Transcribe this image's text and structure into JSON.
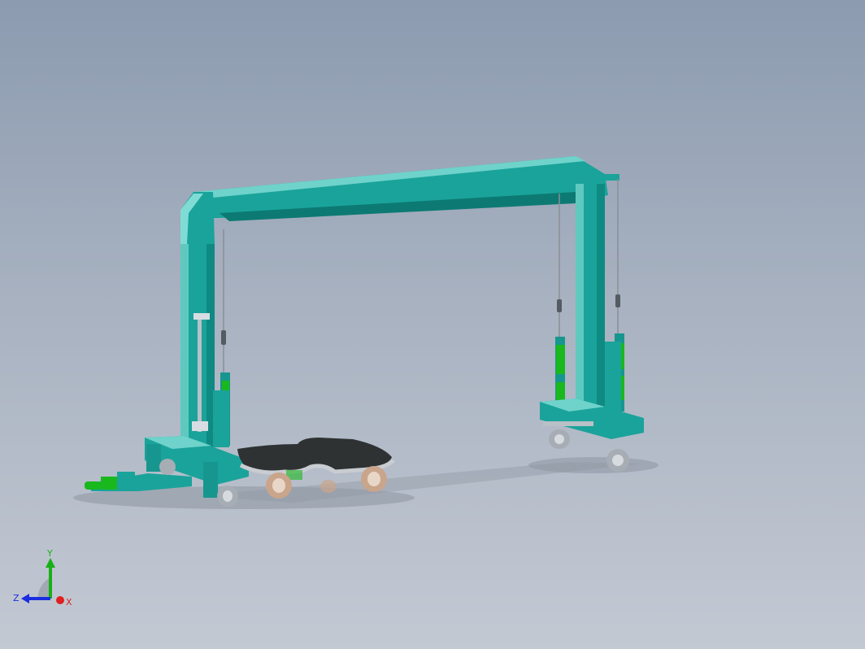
{
  "viewport": {
    "background_top": "#8c9bb0",
    "background_bottom": "#c3c9d3"
  },
  "colors": {
    "frame_primary": "#1aa39a",
    "frame_light": "#6fd3cb",
    "frame_dark": "#0c7a73",
    "cylinder_green": "#19b81c",
    "cable_gray": "#8a8f96",
    "platform_dark": "#2e3232",
    "rail_silver": "#c9ccd0",
    "wheel_tan": "#c9a58b",
    "shadow": "#8e96a3"
  },
  "model": {
    "name": "gantry-crane-assembly",
    "components": [
      "top-beam",
      "left-column",
      "right-column",
      "left-carriage",
      "right-carriage",
      "platform",
      "tow-bar",
      "lifting-cables",
      "hydraulic-cylinders",
      "caster-wheels"
    ]
  },
  "triad": {
    "x_label": "X",
    "y_label": "Y",
    "z_label": "Z",
    "x_color": "#e02020",
    "y_color": "#18b018",
    "z_color": "#1a2ee0"
  }
}
